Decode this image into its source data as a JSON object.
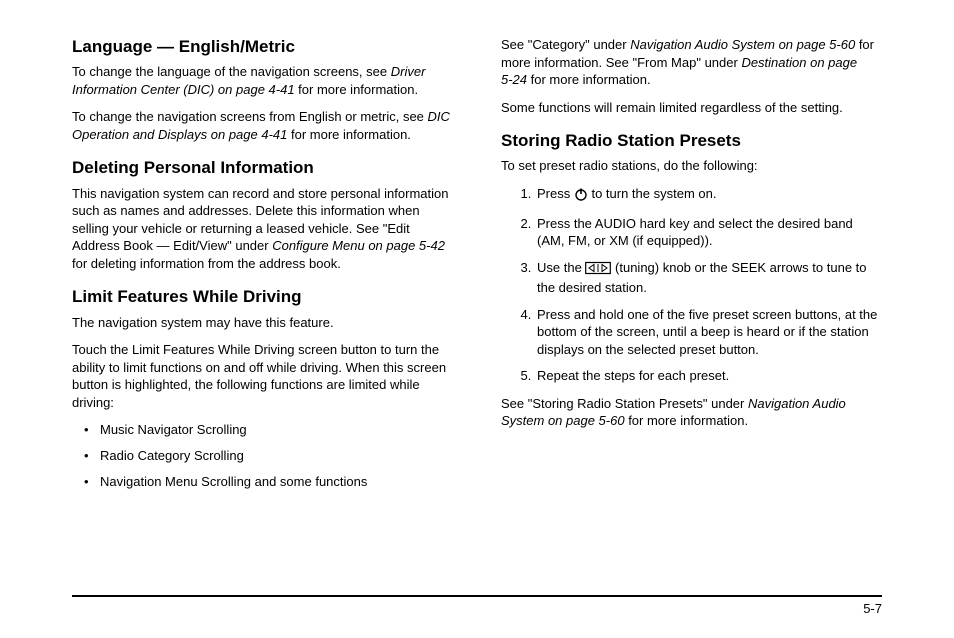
{
  "left": {
    "h_lang": "Language — English/Metric",
    "lang_p1a": "To change the language of the navigation screens, see ",
    "lang_p1_xref": "Driver Information Center (DIC) on page 4‑41",
    "lang_p1b": " for more information.",
    "lang_p2a": "To change the navigation screens from English or metric, see ",
    "lang_p2_xref": "DIC Operation and Displays on page 4‑41",
    "lang_p2b": " for more information.",
    "h_delete": "Deleting Personal Information",
    "delete_p1a": "This navigation system can record and store personal information such as names and addresses. Delete this information when selling your vehicle or returning a leased vehicle. See \"Edit Address Book — Edit/View\" under ",
    "delete_p1_xref": "Configure Menu on page 5‑42",
    "delete_p1b": " for deleting information from the address book.",
    "h_limit": "Limit Features While Driving",
    "limit_p1": "The navigation system may have this feature.",
    "limit_p2": "Touch the Limit Features While Driving screen button to turn the ability to limit functions on and off while driving. When this screen button is highlighted, the following functions are limited while driving:",
    "limit_b1": "Music Navigator Scrolling",
    "limit_b2": "Radio Category Scrolling",
    "limit_b3": "Navigation Menu Scrolling and some functions"
  },
  "right": {
    "top_p1a": "See \"Category\" under ",
    "top_p1_xref1": "Navigation Audio System on page 5‑60",
    "top_p1b": " for more information. See \"From Map\" under ",
    "top_p1_xref2": "Destination on page 5‑24",
    "top_p1c": " for more information.",
    "top_p2": "Some functions will remain limited regardless of the setting.",
    "h_presets": "Storing Radio Station Presets",
    "presets_intro": "To set preset radio stations, do the following:",
    "step1a": "Press ",
    "step1b": " to turn the system on.",
    "step2": "Press the AUDIO hard key and select the desired band (AM, FM, or XM (if equipped)).",
    "step3a": "Use the ",
    "step3b": " (tuning) knob or the SEEK arrows to tune to the desired station.",
    "step4": "Press and hold one of the five preset screen buttons, at the bottom of the screen, until a beep is heard or if the station displays on the selected preset button.",
    "step5": "Repeat the steps for each preset.",
    "presets_out_a": "See \"Storing Radio Station Presets\" under ",
    "presets_out_xref": "Navigation Audio System on page 5‑60",
    "presets_out_b": " for more information."
  },
  "page_number": "5-7"
}
